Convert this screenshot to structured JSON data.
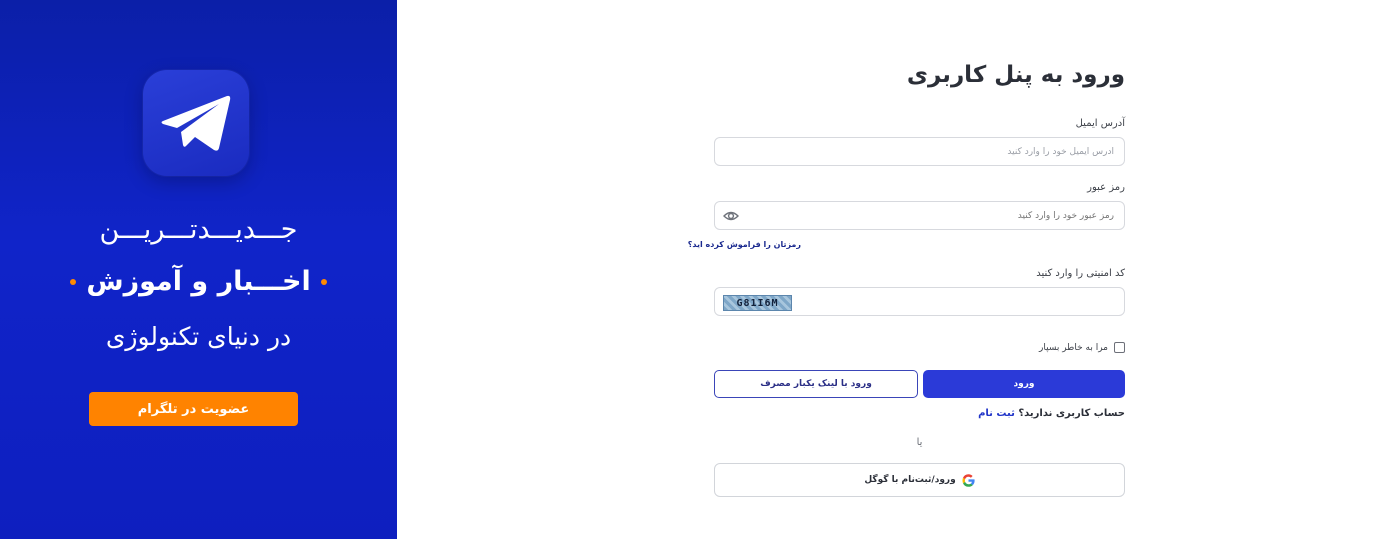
{
  "promo": {
    "line1": "جـــدیـــدتـــریـــن",
    "line2": "اخـــبار و آموزش",
    "line3": "در دنیای تکنولوژی",
    "join_button": "عضویت در تلگرام",
    "accent_color": "#ff8300",
    "background_color": "#1024c9",
    "icon": "telegram-icon"
  },
  "form": {
    "title": "ورود به پنل کاربری",
    "email": {
      "label": "آدرس ایمیل",
      "placeholder": "آدرس ایمیل خود را وارد کنید"
    },
    "password": {
      "label": "رمز عبور",
      "placeholder": "رمز عبور خود را وارد کنید",
      "toggle_icon": "eye-icon"
    },
    "forgot_password": "رمزتان را فراموش کرده اید؟",
    "captcha": {
      "label": "کد امنیتی را وارد کنید",
      "image_text": "G81I6M"
    },
    "remember_me": "مرا به خاطر بسپار",
    "login_button": "ورود",
    "magic_link_button": "ورود با لینک یکبار مصرف",
    "signup_prompt": "حساب کاربری ندارید؟",
    "signup_link": "ثبت نام",
    "or_text": "یا",
    "google_button": "ورود/ثبت‌نام با گوگل",
    "primary_color": "#2b3ad8"
  }
}
